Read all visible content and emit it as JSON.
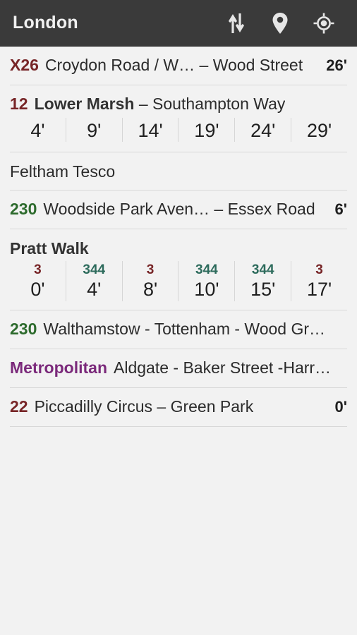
{
  "header": {
    "title": "London",
    "actions": [
      {
        "name": "sort-swap-icon",
        "label": "Sort / swap direction"
      },
      {
        "name": "map-pin-icon",
        "label": "Show on map"
      },
      {
        "name": "my-location-icon",
        "label": "Locate me"
      }
    ],
    "background": "#3a3a3a",
    "title_color": "#f0f0f0"
  },
  "colors": {
    "bus_red": "#772527",
    "bus_green": "#2d6b2d",
    "bus_teal": "#2d6b5c",
    "tube_purple": "#7b2a7b",
    "divider": "#d8d8d8",
    "page_bg": "#f2f2f2"
  },
  "departures": [
    {
      "kind": "single",
      "route": "X26",
      "route_color": "#772527",
      "stop": "Croydon Road / W…",
      "separator": " – ",
      "destination": "Wood Street",
      "stop_bold": false,
      "eta": "26'"
    },
    {
      "kind": "group",
      "route": "12",
      "route_color": "#772527",
      "stop": "Lower Marsh",
      "separator": " – ",
      "destination": "Southampton Way",
      "stop_bold": true,
      "times": [
        {
          "value": "4'"
        },
        {
          "value": "9'"
        },
        {
          "value": "14'"
        },
        {
          "value": "19'"
        },
        {
          "value": "24'"
        },
        {
          "value": "29'"
        }
      ]
    },
    {
      "kind": "stop-only",
      "stop": "Feltham Tesco",
      "stop_bold": false
    },
    {
      "kind": "single",
      "route": "230",
      "route_color": "#2d6b2d",
      "stop": "Woodside Park Aven…",
      "separator": " – ",
      "destination": "Essex Road",
      "stop_bold": false,
      "eta": "6'"
    },
    {
      "kind": "group-multiroute",
      "stop": "Pratt Walk",
      "stop_bold": true,
      "times": [
        {
          "route": "3",
          "route_color": "#772527",
          "value": "0'"
        },
        {
          "route": "344",
          "route_color": "#2d6b5c",
          "value": "4'"
        },
        {
          "route": "3",
          "route_color": "#772527",
          "value": "8'"
        },
        {
          "route": "344",
          "route_color": "#2d6b5c",
          "value": "10'"
        },
        {
          "route": "344",
          "route_color": "#2d6b5c",
          "value": "15'"
        },
        {
          "route": "3",
          "route_color": "#772527",
          "value": "17'"
        }
      ]
    },
    {
      "kind": "single",
      "route": "230",
      "route_color": "#2d6b2d",
      "stop": "Walthamstow - Tottenham - Wood Gr…",
      "separator": "",
      "destination": "",
      "stop_bold": false,
      "eta": ""
    },
    {
      "kind": "single",
      "route": "Metropolitan",
      "route_color": "#7b2a7b",
      "stop": "Aldgate - Baker Street -Harr…",
      "separator": "",
      "destination": "",
      "stop_bold": false,
      "eta": ""
    },
    {
      "kind": "single",
      "route": "22",
      "route_color": "#772527",
      "stop": "Piccadilly Circus",
      "separator": " – ",
      "destination": "Green Park",
      "stop_bold": false,
      "eta": "0'"
    }
  ]
}
